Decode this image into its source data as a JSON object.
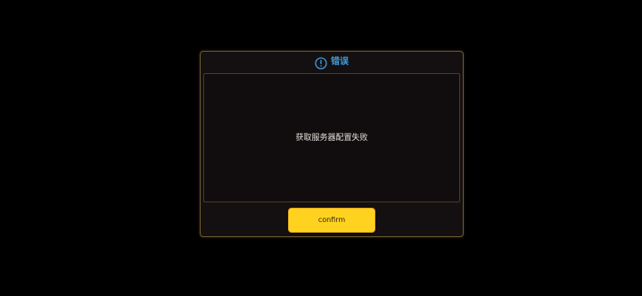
{
  "dialog": {
    "title": "错误",
    "title_icon": "alert-circle-icon",
    "message": "获取服务器配置失败",
    "confirm_label": "confirm"
  },
  "colors": {
    "background": "#000000",
    "dialog_bg": "#141011",
    "dialog_border": "#6e5a2c",
    "title": "#3f9bd9",
    "message": "#e6e2dc",
    "button_bg": "#ffd21f",
    "button_text": "#2a2414"
  }
}
